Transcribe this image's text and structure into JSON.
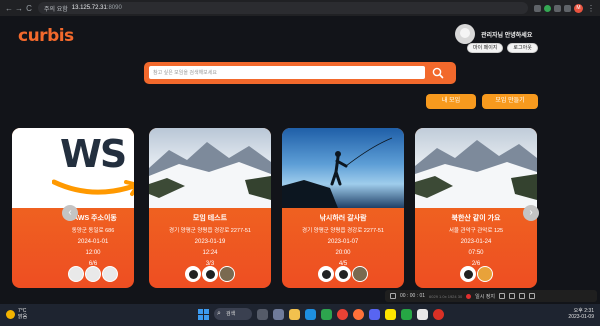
{
  "browser": {
    "nav_back": "←",
    "nav_forward": "→",
    "nav_reload": "C",
    "security_warning": "주의 요함",
    "host": "13.125.72.31",
    "port": ":8090",
    "profile_initial": "M"
  },
  "header": {
    "logo": "curbis",
    "greeting": "관리자님 안녕하세요",
    "my_page_label": "마이 페이지",
    "logout_label": "로그아웃"
  },
  "search": {
    "placeholder": "참고 싶은 모임을 검색해보세요",
    "value": ""
  },
  "actions": {
    "my_groups_label": "내 모임",
    "create_group_label": "모임 만들기"
  },
  "carousel": {
    "prev_label": "‹",
    "next_label": "›",
    "cards": [
      {
        "title": "- AWS 주소이동",
        "address": "동양군 동일로 686",
        "date": "2024-01-01",
        "time": "12:00",
        "count": "6/6",
        "image": "aws-logo",
        "logo_text": "WS"
      },
      {
        "title": "모임 테스트",
        "address": "경기 양평군 양평읍 경강로 2277-51",
        "date": "2023-01-19",
        "time": "12:24",
        "count": "3/3",
        "image": "snowy-mountains"
      },
      {
        "title": "낚시하러 갈사람",
        "address": "경기 양평군 양평읍 경강로 2277-51",
        "date": "2023-01-07",
        "time": "20:00",
        "count": "4/5",
        "image": "fisherman-silhouette"
      },
      {
        "title": "북한산 같이 가요",
        "address": "서울 관악구 관악로 125",
        "date": "2023-01-24",
        "time": "07:50",
        "count": "2/6",
        "image": "snowy-mountains"
      }
    ]
  },
  "recorder": {
    "timer": "00 : 00 : 01",
    "size_info": "6029 1.0x 1924 30",
    "stop_label": "일시 정지"
  },
  "taskbar": {
    "temperature": "7°C",
    "weather": "맑음",
    "search_label": "검색",
    "time": "오후 2:31",
    "date": "2023-01-09"
  },
  "colors": {
    "accent": "#f2692c",
    "button": "#f79a1e",
    "page_bg": "#121419"
  }
}
